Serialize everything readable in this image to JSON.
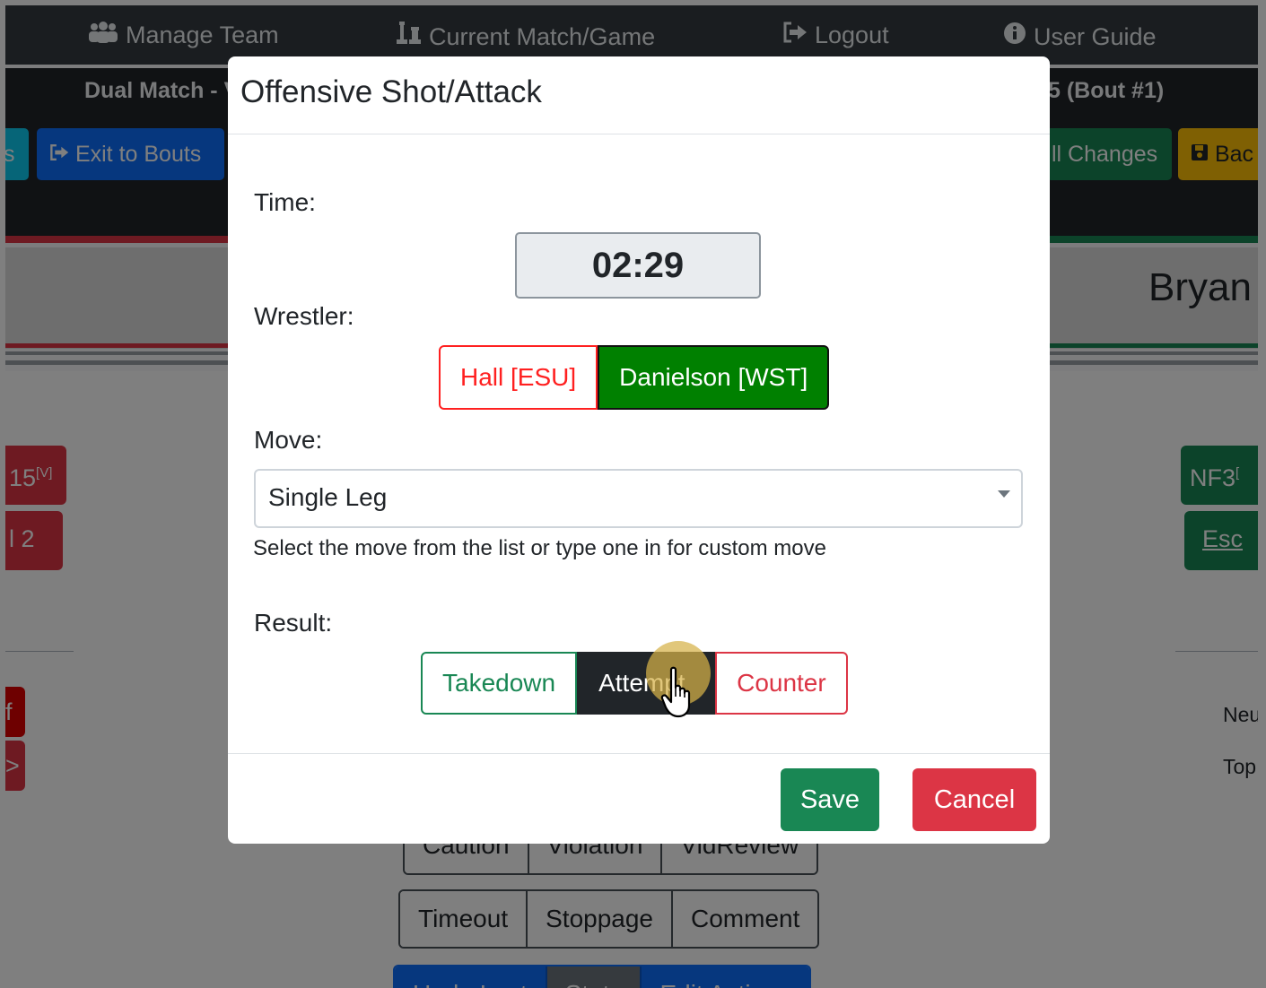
{
  "nav": {
    "manage_team": "Manage Team",
    "current_match": "Current Match/Game",
    "logout": "Logout",
    "user_guide": "User Guide"
  },
  "subbar": {
    "title_left": "Dual Match - V",
    "title_right": "5 (Bout #1)",
    "btn_partial_left": "s",
    "btn_exit": "Exit to Bouts",
    "btn_changes": "ll Changes",
    "btn_back": "Bac"
  },
  "header": {
    "wrestler_name": "Bryan"
  },
  "side": {
    "left_chip1": "15",
    "left_chip1_sup": "[V]",
    "left_chip2": "l 2",
    "left_chip3": "f",
    "left_chip4": ">",
    "right_chip1": "NF3",
    "right_chip1_sup": "[",
    "right_chip2": "Esc",
    "right_label1": "Neu",
    "right_label2": "Top"
  },
  "under_buttons": {
    "row1": [
      "Caution",
      "Violation",
      "VidReview"
    ],
    "row2": [
      "Timeout",
      "Stoppage",
      "Comment"
    ],
    "row3": [
      "Undo Last",
      "Stats",
      "Edit Actions"
    ]
  },
  "modal": {
    "title": "Offensive Shot/Attack",
    "time_label": "Time:",
    "time_value": "02:29",
    "wrestler_label": "Wrestler:",
    "wrestler_red": "Hall [ESU]",
    "wrestler_green": "Danielson [WST]",
    "move_label": "Move:",
    "move_value": "Single Leg",
    "move_help": "Select the move from the list or type one in for custom move",
    "result_label": "Result:",
    "result_takedown": "Takedown",
    "result_attempt": "Attempt",
    "result_counter": "Counter",
    "save": "Save",
    "cancel": "Cancel"
  },
  "colors": {
    "primary": "#0d6efd",
    "success": "#198754",
    "danger": "#dc3545",
    "warning": "#ffc107",
    "info": "#0dcaf0",
    "dark": "#212529",
    "wrestler_green": "#008000",
    "wrestler_red": "#ff2020"
  },
  "icons": [
    "users-icon",
    "chess-icon",
    "logout-icon",
    "info-circle-icon",
    "exit-icon",
    "save-icon",
    "dropdown-caret-icon",
    "hand-pointer-cursor-icon"
  ]
}
